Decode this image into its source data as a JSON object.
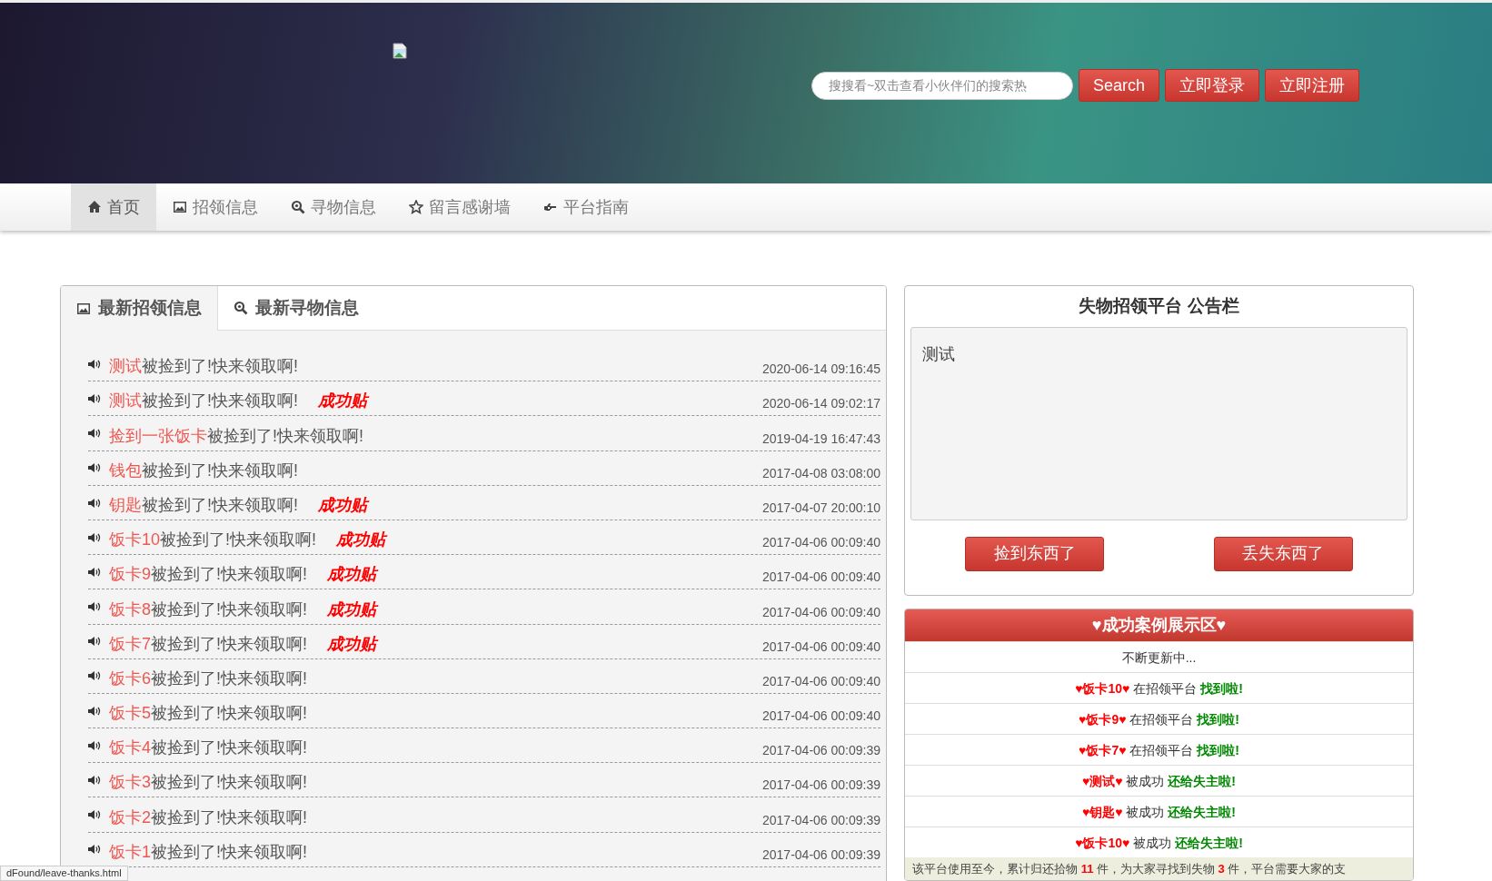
{
  "header": {
    "search": {
      "placeholder": "搜搜看~双击查看小伙伴们的搜索热"
    },
    "buttons": [
      "Search",
      "立即登录",
      "立即注册"
    ]
  },
  "nav": [
    {
      "label": "首页",
      "kind": "home",
      "selected": true
    },
    {
      "label": "招领信息",
      "kind": "picture",
      "selected": false
    },
    {
      "label": "寻物信息",
      "kind": "search",
      "selected": false
    },
    {
      "label": "留言感谢墙",
      "kind": "star",
      "selected": false
    },
    {
      "label": "平台指南",
      "kind": "hand",
      "selected": false
    }
  ],
  "tabs": [
    {
      "label": "最新招领信息",
      "kind": "picture",
      "selected": true
    },
    {
      "label": "最新寻物信息",
      "kind": "search",
      "selected": false
    }
  ],
  "items": [
    {
      "name": "测试",
      "text": "被捡到了!快来领取啊!",
      "time": "2020-06-14 09:16:45"
    },
    {
      "name": "测试",
      "text": "被捡到了!快来领取啊!",
      "tag": "成功贴",
      "time": "2020-06-14 09:02:17"
    },
    {
      "name": "捡到一张饭卡",
      "text": "被捡到了!快来领取啊!",
      "time": "2019-04-19 16:47:43"
    },
    {
      "name": "钱包",
      "text": "被捡到了!快来领取啊!",
      "time": "2017-04-08 03:08:00"
    },
    {
      "name": "钥匙",
      "text": "被捡到了!快来领取啊!",
      "tag": "成功贴",
      "time": "2017-04-07 20:00:10"
    },
    {
      "name": "饭卡10",
      "text": "被捡到了!快来领取啊!",
      "tag": "成功贴",
      "time": "2017-04-06 00:09:40"
    },
    {
      "name": "饭卡9",
      "text": "被捡到了!快来领取啊!",
      "tag": "成功贴",
      "time": "2017-04-06 00:09:40"
    },
    {
      "name": "饭卡8",
      "text": "被捡到了!快来领取啊!",
      "tag": "成功贴",
      "time": "2017-04-06 00:09:40"
    },
    {
      "name": "饭卡7",
      "text": "被捡到了!快来领取啊!",
      "tag": "成功贴",
      "time": "2017-04-06 00:09:40"
    },
    {
      "name": "饭卡6",
      "text": "被捡到了!快来领取啊!",
      "time": "2017-04-06 00:09:40"
    },
    {
      "name": "饭卡5",
      "text": "被捡到了!快来领取啊!",
      "time": "2017-04-06 00:09:40"
    },
    {
      "name": "饭卡4",
      "text": "被捡到了!快来领取啊!",
      "time": "2017-04-06 00:09:39"
    },
    {
      "name": "饭卡3",
      "text": "被捡到了!快来领取啊!",
      "time": "2017-04-06 00:09:39"
    },
    {
      "name": "饭卡2",
      "text": "被捡到了!快来领取啊!",
      "time": "2017-04-06 00:09:39"
    },
    {
      "name": "饭卡1",
      "text": "被捡到了!快来领取啊!",
      "time": "2017-04-06 00:09:39"
    }
  ],
  "notice": {
    "title": "失物招领平台 公告栏",
    "body": "测试",
    "buttons": [
      "捡到东西了",
      "丢失东西了"
    ]
  },
  "success": {
    "title": "♥成功案例展示区♥",
    "subtitle": "不断更新中...",
    "cases": [
      {
        "name": "♥饭卡10♥",
        "middle": "在招领平台",
        "result": "找到啦!"
      },
      {
        "name": "♥饭卡9♥",
        "middle": "在招领平台",
        "result": "找到啦!"
      },
      {
        "name": "♥饭卡7♥",
        "middle": "在招领平台",
        "result": "找到啦!"
      },
      {
        "name": "♥测试♥",
        "middle": "被成功",
        "result": "还给失主啦!"
      },
      {
        "name": "♥钥匙♥",
        "middle": "被成功",
        "result": "还给失主啦!"
      },
      {
        "name": "♥饭卡10♥",
        "middle": "被成功",
        "result": "还给失主啦!"
      }
    ],
    "footer": "该平台使用至今，累计归还拾物 **11** 件，为大家寻找到失物 **3** 件，平台需要大家的支"
  },
  "status_bar": {
    "url": "dFound/leave-thanks.html"
  }
}
